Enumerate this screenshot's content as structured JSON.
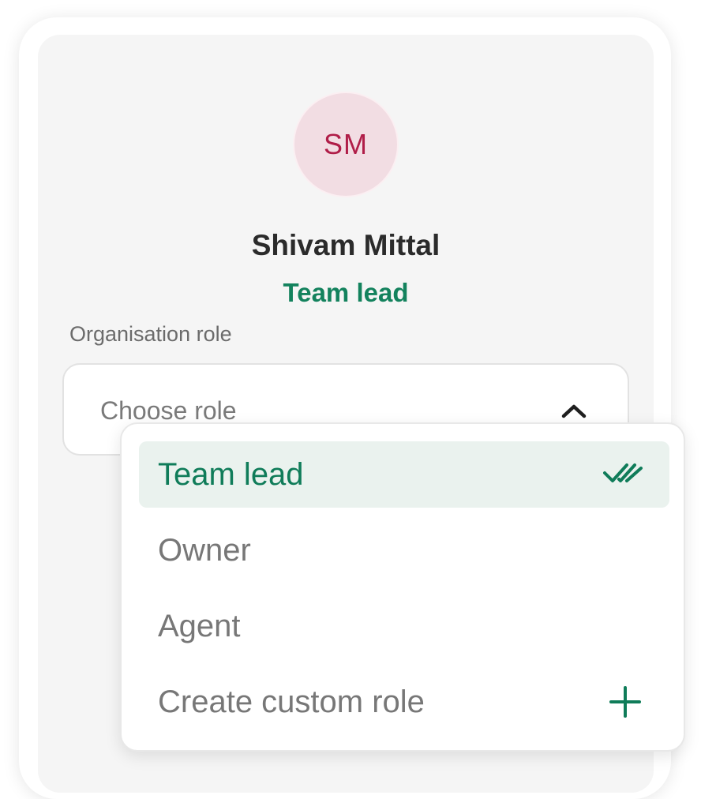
{
  "profile": {
    "initials": "SM",
    "name": "Shivam Mittal",
    "role": "Team lead"
  },
  "role_field": {
    "label": "Organisation role",
    "placeholder": "Choose role",
    "expanded": true
  },
  "dropdown": {
    "options": [
      {
        "label": "Team lead",
        "selected": true,
        "icon": "double-check-icon"
      },
      {
        "label": "Owner",
        "selected": false
      },
      {
        "label": "Agent",
        "selected": false
      },
      {
        "label": "Create custom role",
        "selected": false,
        "icon": "plus-icon"
      }
    ]
  },
  "colors": {
    "accent": "#13825d",
    "avatar_bg": "#f2dde3",
    "avatar_text": "#b01d48",
    "selected_bg": "#eaf2ee"
  }
}
